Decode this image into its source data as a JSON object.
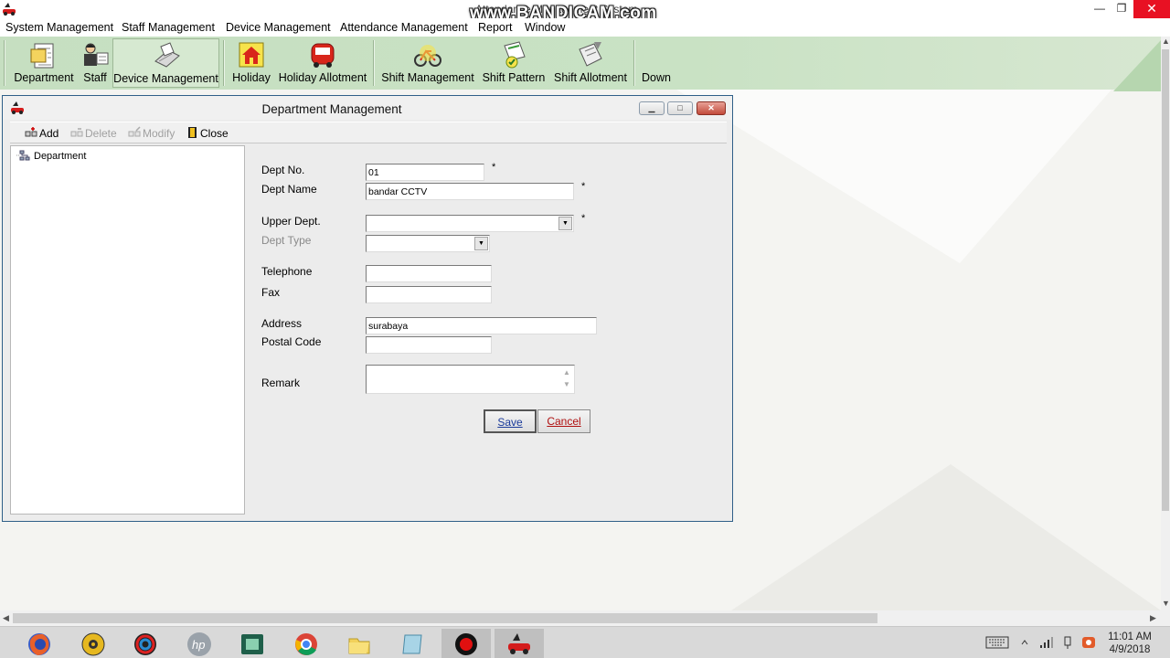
{
  "app": {
    "title": "Attendance Management System",
    "watermark": "www.BANDICAM.com",
    "window_controls": {
      "minimize": "—",
      "maximize": "❐",
      "close": "✕"
    }
  },
  "menu": [
    "System Management",
    "Staff Management",
    "Device Management",
    "Attendance Management",
    "Report",
    "Window"
  ],
  "toolbar": {
    "buttons": [
      {
        "label": "Department",
        "icon": "department-icon"
      },
      {
        "label": "Staff",
        "icon": "staff-icon"
      },
      {
        "label": "Device Management",
        "icon": "device-management-icon"
      },
      {
        "label": "Holiday",
        "icon": "holiday-icon"
      },
      {
        "label": "Holiday Allotment",
        "icon": "holiday-allotment-icon"
      },
      {
        "label": "Shift Management",
        "icon": "shift-management-icon"
      },
      {
        "label": "Shift Pattern",
        "icon": "shift-pattern-icon"
      },
      {
        "label": "Shift Allotment",
        "icon": "shift-allotment-icon"
      },
      {
        "label": "Down",
        "icon": "download-icon"
      }
    ]
  },
  "child_window": {
    "title": "Department Management",
    "toolbar": {
      "add": "Add",
      "delete": "Delete",
      "modify": "Modify",
      "close": "Close"
    },
    "tree": {
      "root": "Department"
    },
    "form": {
      "dept_no": {
        "label": "Dept No.",
        "value": "01",
        "required": "*"
      },
      "dept_name": {
        "label": "Dept Name",
        "value": "bandar CCTV",
        "required": "*"
      },
      "upper_dept": {
        "label": "Upper Dept.",
        "value": "",
        "required": "*"
      },
      "dept_type": {
        "label": "Dept Type",
        "value": ""
      },
      "telephone": {
        "label": "Telephone",
        "value": ""
      },
      "fax": {
        "label": "Fax",
        "value": ""
      },
      "address": {
        "label": "Address",
        "value": "surabaya"
      },
      "postal_code": {
        "label": "Postal Code",
        "value": ""
      },
      "remark": {
        "label": "Remark",
        "value": ""
      },
      "save": "Save",
      "cancel": "Cancel"
    }
  },
  "taskbar": {
    "apps": [
      "firefox-icon",
      "media-player-icon",
      "color-app-icon",
      "hp-icon",
      "film-app-icon",
      "chrome-icon",
      "file-explorer-icon",
      "notes-icon",
      "bandicam-record-icon",
      "attendance-app-icon"
    ],
    "clock": {
      "time": "11:01 AM",
      "date": "4/9/2018"
    }
  },
  "colors": {
    "toolbar_bg": "#c9e2c4",
    "close_red": "#e81123",
    "save_text": "#1a3a9a",
    "cancel_text": "#b01010"
  }
}
